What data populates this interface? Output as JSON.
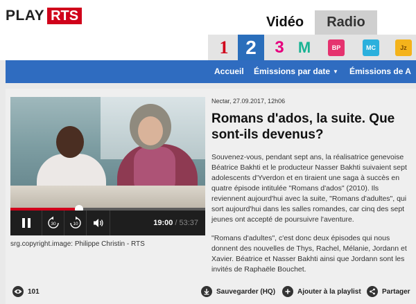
{
  "header": {
    "logo_play": "PLAY",
    "logo_rts": "RTS",
    "tab_video": "Vidéo",
    "tab_radio": "Radio"
  },
  "channels": [
    {
      "label": "1",
      "name": "la-1ere",
      "color": "#d0021b"
    },
    {
      "label": "2",
      "name": "espace-2",
      "color": "#2a6ebb",
      "active": true
    },
    {
      "label": "3",
      "name": "couleur-3",
      "color": "#e6007e"
    },
    {
      "label": "M",
      "name": "option-musique",
      "color": "#19b394"
    },
    {
      "label": "BP",
      "name": "radio-bp",
      "color": "#e5336f"
    },
    {
      "label": "MC",
      "name": "radio-mc",
      "color": "#2bb0dd"
    },
    {
      "label": "Jz",
      "name": "radio-jazz",
      "color": "#f4b31b"
    }
  ],
  "nav": {
    "accueil": "Accueil",
    "emissions_date": "Émissions par date",
    "emissions_az": "Émissions de A à Z"
  },
  "player": {
    "progress_fraction": 0.354,
    "back_label": "30",
    "fwd_label": "10",
    "time_current": "19:00",
    "time_separator": "/",
    "time_total": "53:37"
  },
  "copyright": "srg.copyright.image: Philippe Christin - RTS",
  "article": {
    "meta": "Nectar, 27.09.2017, 12h06",
    "title": "Romans d'ados, la suite. Que sont-ils devenus?",
    "para1": "Souvenez-vous, pendant sept ans, la réalisatrice genevoise Béatrice Bakhti et le producteur Nasser Bakhti suivaient sept adolescents d'Yverdon et en tiraient une saga à succès en quatre épisode intitulée \"Romans d'ados\" (2010). Ils reviennent aujourd'hui avec la suite, \"Romans d'adultes\", qui sort aujourd'hui dans les salles romandes, car cinq des sept jeunes ont accepté de poursuivre l'aventure.",
    "para2": "\"Romans d'adultes\", c'est donc deux épisodes qui nous donnent des nouvelles de Thys, Rachel, Mélanie, Jordann et Xavier. Béatrice et Nasser Bakhti ainsi que Jordann sont les invités de Raphaële Bouchet."
  },
  "footer": {
    "views": "101",
    "save": "Sauvegarder (HQ)",
    "playlist": "Ajouter à la playlist",
    "share": "Partager"
  }
}
